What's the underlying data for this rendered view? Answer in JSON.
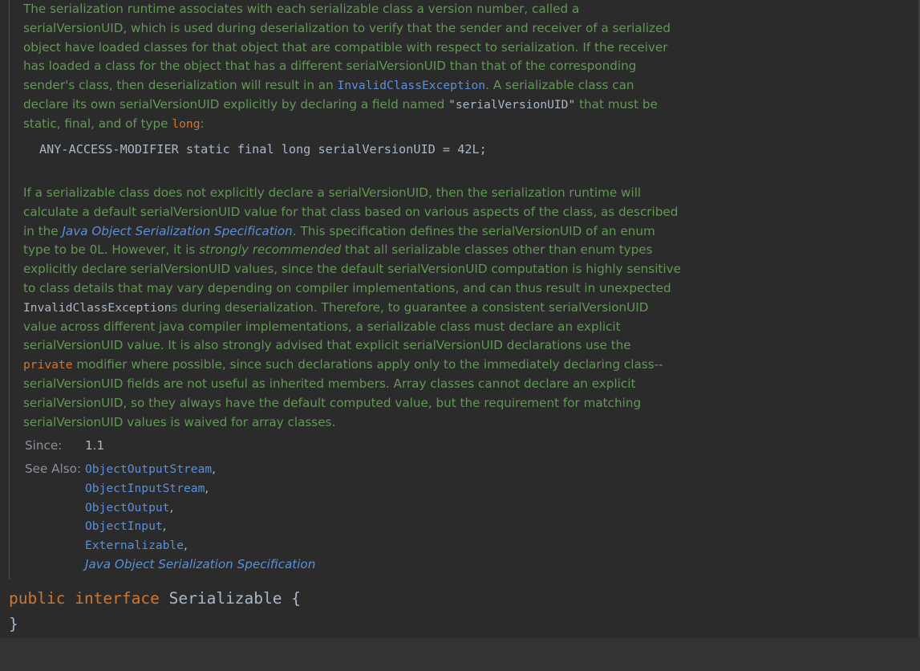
{
  "doc": {
    "p1": {
      "t1": "The serialization runtime associates with each serializable class a version number, called a serialVersionUID, which is used during deserialization to verify that the sender and receiver of a serialized object have loaded classes for that object that are compatible with respect to serialization. If the receiver has loaded a class for the object that has a different serialVersionUID than that of the corresponding sender's class, then deserialization will result in an ",
      "link1": "InvalidClassException",
      "t2": ". A serializable class can declare its own serialVersionUID explicitly by declaring a field named ",
      "code1": "\"serialVersionUID\"",
      "t3": " that must be static, final, and of type ",
      "code2": "long",
      "t4": ":"
    },
    "code_example": "ANY-ACCESS-MODIFIER static final long serialVersionUID = 42L;",
    "p2": {
      "t1": "If a serializable class does not explicitly declare a serialVersionUID, then the serialization runtime will calculate a default serialVersionUID value for that class based on various aspects of the class, as described in the ",
      "link1": "Java Object Serialization Specification",
      "t2": ". This specification defines the serialVersionUID of an enum type to be 0L. However, it is ",
      "em1": "strongly recommended",
      "t3": " that all serializable classes other than enum types explicitly declare serialVersionUID values, since the default serialVersionUID computation is highly sensitive to class details that may vary depending on compiler implementations, and can thus result in unexpected ",
      "code1": "InvalidClassException",
      "t4": "s during deserialization. Therefore, to guarantee a consistent serialVersionUID value across different java compiler implementations, a serializable class must declare an explicit serialVersionUID value. It is also strongly advised that explicit serialVersionUID declarations use the ",
      "code2": "private",
      "t5": " modifier where possible, since such declarations apply only to the immediately declaring class--serialVersionUID fields are not useful as inherited members. Array classes cannot declare an explicit serialVersionUID, so they always have the default computed value, but the requirement for matching serialVersionUID values is waived for array classes."
    },
    "since_label": "Since:",
    "since_value": "1.1",
    "see_also_label": "See Also:",
    "see_also": [
      "ObjectOutputStream",
      "ObjectInputStream",
      "ObjectOutput",
      "ObjectInput",
      "Externalizable"
    ],
    "see_also_spec": "Java Object Serialization Specification",
    "comma": ","
  },
  "code": {
    "kw_public": "public",
    "kw_interface": "interface",
    "class_name": "Serializable",
    "open_brace": "{",
    "close_brace": "}"
  },
  "colors": {
    "background": "#2b2b2b",
    "doc_text": "#629755",
    "link": "#5b8fd9",
    "keyword": "#cc7832",
    "identifier": "#a9b7c6"
  }
}
